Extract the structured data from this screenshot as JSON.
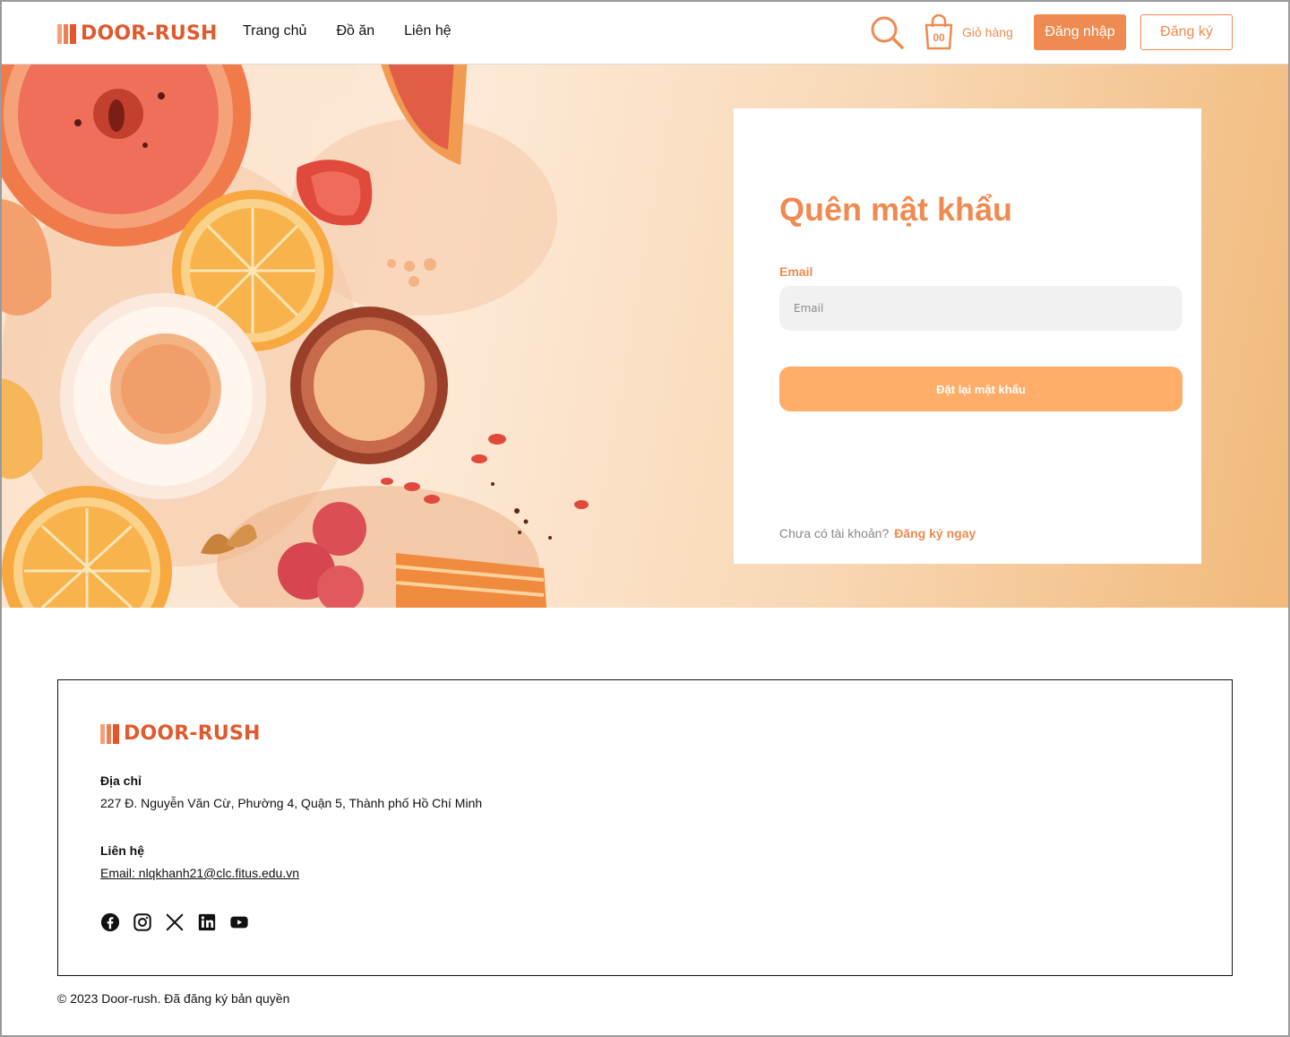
{
  "brand": {
    "name": "DOOR-RUSH",
    "accent": "#ef8a51",
    "logo_color": "#e05a2d"
  },
  "nav": {
    "items": [
      "Trang chủ",
      "Đồ ăn",
      "Liên hệ"
    ]
  },
  "header": {
    "search_icon": "search-icon",
    "cart": {
      "icon": "shopping-bag-icon",
      "count": "00",
      "label": "Giỏ hàng"
    },
    "login_label": "Đăng nhập",
    "register_label": "Đăng ký"
  },
  "form": {
    "title": "Quên mật khẩu",
    "email_label": "Email",
    "email_placeholder": "Email",
    "email_value": "",
    "submit_label": "Đặt lại mật khẩu",
    "signup_question": "Chưa có tài khoản?",
    "signup_link": "Đăng ký ngay"
  },
  "footer": {
    "brand": "DOOR-RUSH",
    "address_heading": "Địa chỉ",
    "address": "227 Đ. Nguyễn Văn Cừ, Phường 4, Quận 5, Thành phố Hồ Chí Minh",
    "contact_heading": "Liên hệ",
    "contact_email": "Email: nlqkhanh21@clc.fitus.edu.vn",
    "socials": [
      "facebook-icon",
      "instagram-icon",
      "x-icon",
      "linkedin-icon",
      "youtube-icon"
    ],
    "copyright": "© 2023 Door-rush. Đã đăng ký bản quyền"
  }
}
